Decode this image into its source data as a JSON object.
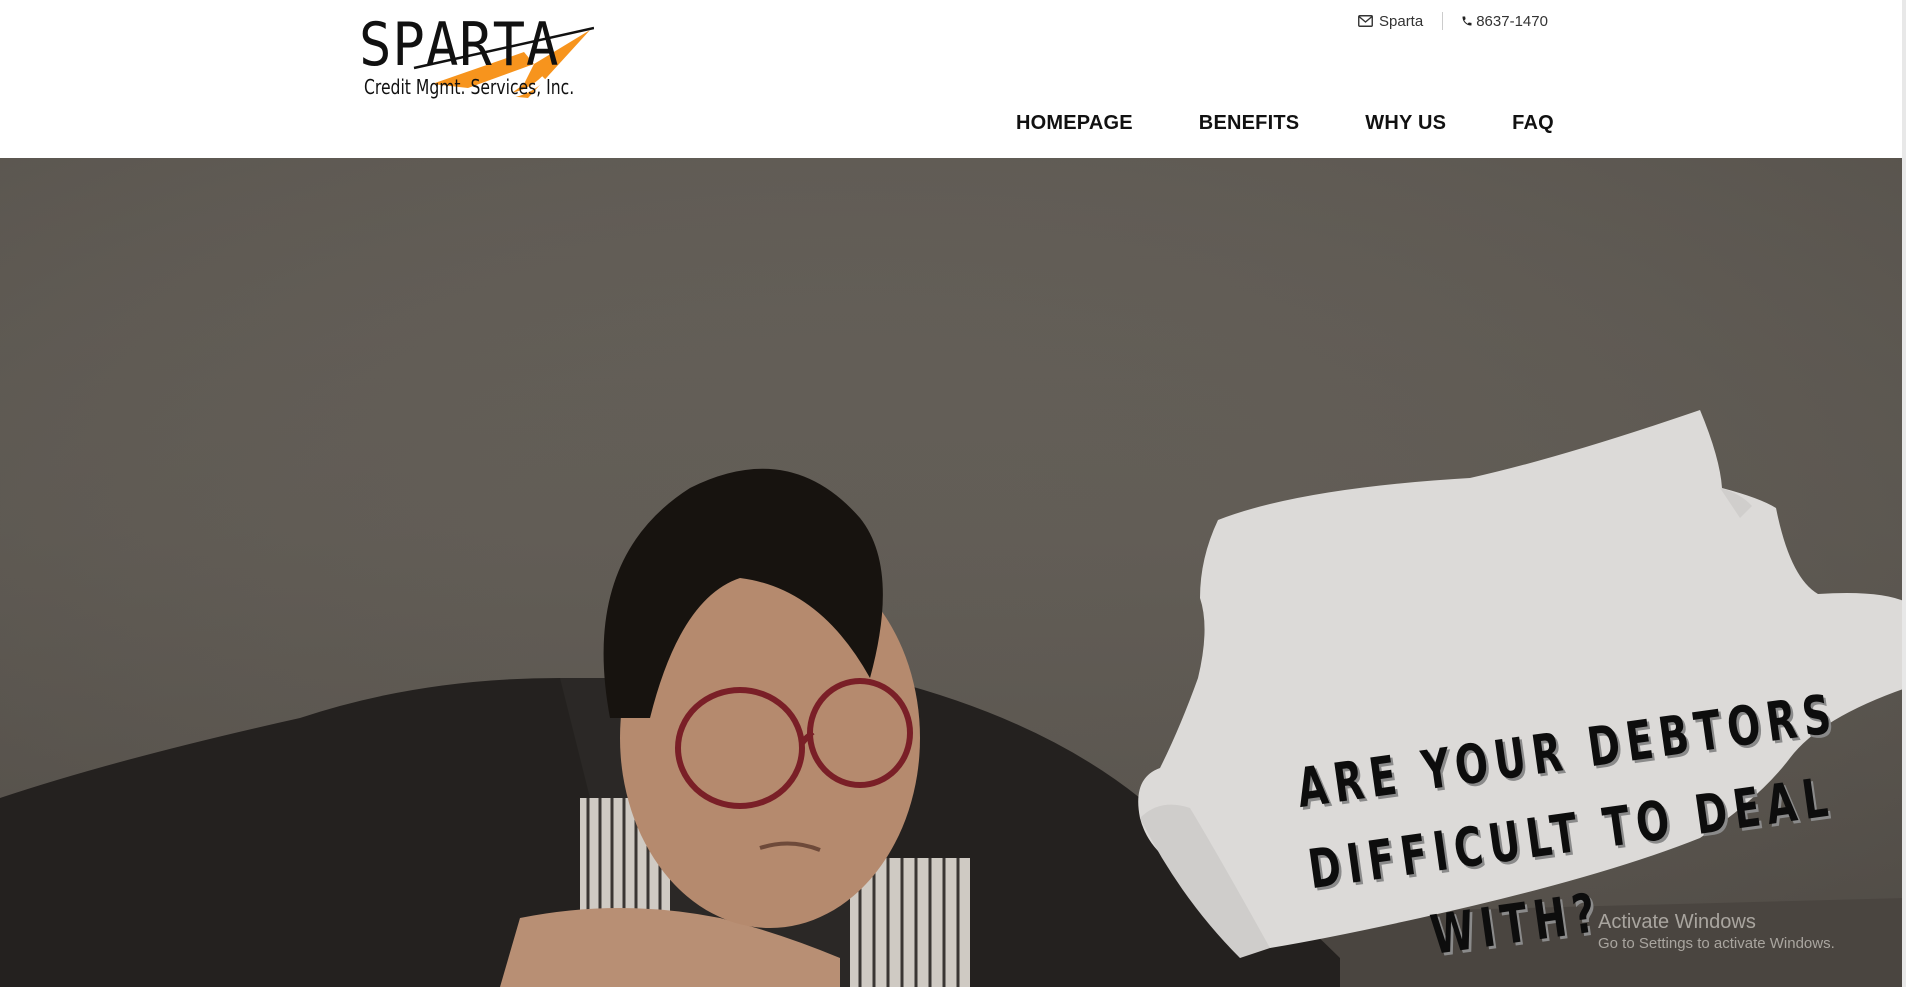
{
  "header": {
    "logo": {
      "wordmark": "SPARTA",
      "subtitle": "Credit Mgmt. Services, Inc."
    },
    "contact": {
      "email_label": "Sparta",
      "phone_label": "8637-1470"
    },
    "nav": [
      {
        "label": "HOMEPAGE"
      },
      {
        "label": "BENEFITS"
      },
      {
        "label": "WHY US"
      },
      {
        "label": "FAQ"
      }
    ]
  },
  "hero": {
    "headline_lines": [
      "ARE YOUR DEBTORS",
      "DIFFICULT TO DEAL",
      "WITH?"
    ]
  },
  "os_watermark": {
    "title": "Activate Windows",
    "subtitle": "Go to Settings to activate Windows."
  },
  "colors": {
    "accent": "#f7941d",
    "text": "#111111",
    "hero_overlay": "#625d56"
  },
  "icons": [
    "envelope-icon",
    "phone-icon"
  ]
}
